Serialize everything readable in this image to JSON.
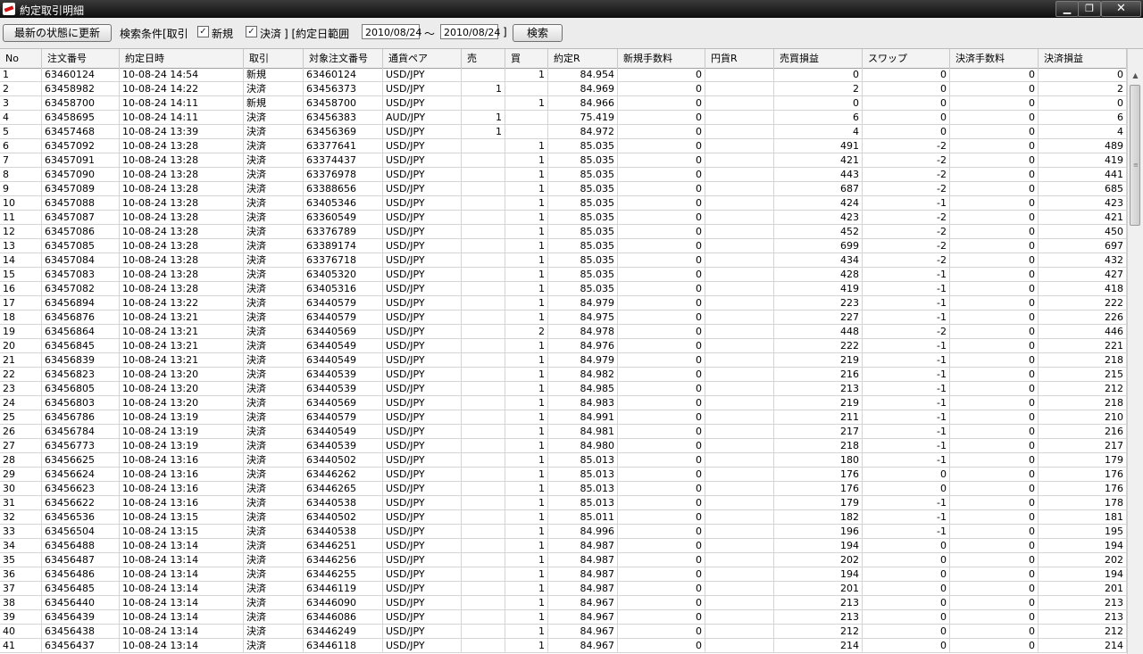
{
  "window": {
    "title": "約定取引明細",
    "min": "▁",
    "max": "❐",
    "close": "✕"
  },
  "toolbar": {
    "refresh_label": "最新の状態に更新",
    "criteria_label": "検索条件[取引",
    "new_checked": true,
    "new_label": "新規",
    "settle_checked": true,
    "settle_label": "決済",
    "range_label": "]  [約定日範囲",
    "date_from": "2010/08/24",
    "tilde": "～",
    "date_to": "2010/08/24",
    "close_bracket": "]",
    "search_label": "検索"
  },
  "grid": {
    "columns": [
      "No",
      "注文番号",
      "約定日時",
      "取引",
      "対象注文番号",
      "通貨ペア",
      "売",
      "買",
      "約定R",
      "新規手数料",
      "円貨R",
      "売買損益",
      "スワップ",
      "決済手数料",
      "決済損益"
    ],
    "rows": [
      [
        "1",
        "63460124",
        "10-08-24 14:54",
        "新規",
        "63460124",
        "USD/JPY",
        "",
        "1",
        "84.954",
        "0",
        "",
        "0",
        "0",
        "0",
        "0"
      ],
      [
        "2",
        "63458982",
        "10-08-24 14:22",
        "決済",
        "63456373",
        "USD/JPY",
        "1",
        "",
        "84.969",
        "0",
        "",
        "2",
        "0",
        "0",
        "2"
      ],
      [
        "3",
        "63458700",
        "10-08-24 14:11",
        "新規",
        "63458700",
        "USD/JPY",
        "",
        "1",
        "84.966",
        "0",
        "",
        "0",
        "0",
        "0",
        "0"
      ],
      [
        "4",
        "63458695",
        "10-08-24 14:11",
        "決済",
        "63456383",
        "AUD/JPY",
        "1",
        "",
        "75.419",
        "0",
        "",
        "6",
        "0",
        "0",
        "6"
      ],
      [
        "5",
        "63457468",
        "10-08-24 13:39",
        "決済",
        "63456369",
        "USD/JPY",
        "1",
        "",
        "84.972",
        "0",
        "",
        "4",
        "0",
        "0",
        "4"
      ],
      [
        "6",
        "63457092",
        "10-08-24 13:28",
        "決済",
        "63377641",
        "USD/JPY",
        "",
        "1",
        "85.035",
        "0",
        "",
        "491",
        "-2",
        "0",
        "489"
      ],
      [
        "7",
        "63457091",
        "10-08-24 13:28",
        "決済",
        "63374437",
        "USD/JPY",
        "",
        "1",
        "85.035",
        "0",
        "",
        "421",
        "-2",
        "0",
        "419"
      ],
      [
        "8",
        "63457090",
        "10-08-24 13:28",
        "決済",
        "63376978",
        "USD/JPY",
        "",
        "1",
        "85.035",
        "0",
        "",
        "443",
        "-2",
        "0",
        "441"
      ],
      [
        "9",
        "63457089",
        "10-08-24 13:28",
        "決済",
        "63388656",
        "USD/JPY",
        "",
        "1",
        "85.035",
        "0",
        "",
        "687",
        "-2",
        "0",
        "685"
      ],
      [
        "10",
        "63457088",
        "10-08-24 13:28",
        "決済",
        "63405346",
        "USD/JPY",
        "",
        "1",
        "85.035",
        "0",
        "",
        "424",
        "-1",
        "0",
        "423"
      ],
      [
        "11",
        "63457087",
        "10-08-24 13:28",
        "決済",
        "63360549",
        "USD/JPY",
        "",
        "1",
        "85.035",
        "0",
        "",
        "423",
        "-2",
        "0",
        "421"
      ],
      [
        "12",
        "63457086",
        "10-08-24 13:28",
        "決済",
        "63376789",
        "USD/JPY",
        "",
        "1",
        "85.035",
        "0",
        "",
        "452",
        "-2",
        "0",
        "450"
      ],
      [
        "13",
        "63457085",
        "10-08-24 13:28",
        "決済",
        "63389174",
        "USD/JPY",
        "",
        "1",
        "85.035",
        "0",
        "",
        "699",
        "-2",
        "0",
        "697"
      ],
      [
        "14",
        "63457084",
        "10-08-24 13:28",
        "決済",
        "63376718",
        "USD/JPY",
        "",
        "1",
        "85.035",
        "0",
        "",
        "434",
        "-2",
        "0",
        "432"
      ],
      [
        "15",
        "63457083",
        "10-08-24 13:28",
        "決済",
        "63405320",
        "USD/JPY",
        "",
        "1",
        "85.035",
        "0",
        "",
        "428",
        "-1",
        "0",
        "427"
      ],
      [
        "16",
        "63457082",
        "10-08-24 13:28",
        "決済",
        "63405316",
        "USD/JPY",
        "",
        "1",
        "85.035",
        "0",
        "",
        "419",
        "-1",
        "0",
        "418"
      ],
      [
        "17",
        "63456894",
        "10-08-24 13:22",
        "決済",
        "63440579",
        "USD/JPY",
        "",
        "1",
        "84.979",
        "0",
        "",
        "223",
        "-1",
        "0",
        "222"
      ],
      [
        "18",
        "63456876",
        "10-08-24 13:21",
        "決済",
        "63440579",
        "USD/JPY",
        "",
        "1",
        "84.975",
        "0",
        "",
        "227",
        "-1",
        "0",
        "226"
      ],
      [
        "19",
        "63456864",
        "10-08-24 13:21",
        "決済",
        "63440569",
        "USD/JPY",
        "",
        "2",
        "84.978",
        "0",
        "",
        "448",
        "-2",
        "0",
        "446"
      ],
      [
        "20",
        "63456845",
        "10-08-24 13:21",
        "決済",
        "63440549",
        "USD/JPY",
        "",
        "1",
        "84.976",
        "0",
        "",
        "222",
        "-1",
        "0",
        "221"
      ],
      [
        "21",
        "63456839",
        "10-08-24 13:21",
        "決済",
        "63440549",
        "USD/JPY",
        "",
        "1",
        "84.979",
        "0",
        "",
        "219",
        "-1",
        "0",
        "218"
      ],
      [
        "22",
        "63456823",
        "10-08-24 13:20",
        "決済",
        "63440539",
        "USD/JPY",
        "",
        "1",
        "84.982",
        "0",
        "",
        "216",
        "-1",
        "0",
        "215"
      ],
      [
        "23",
        "63456805",
        "10-08-24 13:20",
        "決済",
        "63440539",
        "USD/JPY",
        "",
        "1",
        "84.985",
        "0",
        "",
        "213",
        "-1",
        "0",
        "212"
      ],
      [
        "24",
        "63456803",
        "10-08-24 13:20",
        "決済",
        "63440569",
        "USD/JPY",
        "",
        "1",
        "84.983",
        "0",
        "",
        "219",
        "-1",
        "0",
        "218"
      ],
      [
        "25",
        "63456786",
        "10-08-24 13:19",
        "決済",
        "63440579",
        "USD/JPY",
        "",
        "1",
        "84.991",
        "0",
        "",
        "211",
        "-1",
        "0",
        "210"
      ],
      [
        "26",
        "63456784",
        "10-08-24 13:19",
        "決済",
        "63440549",
        "USD/JPY",
        "",
        "1",
        "84.981",
        "0",
        "",
        "217",
        "-1",
        "0",
        "216"
      ],
      [
        "27",
        "63456773",
        "10-08-24 13:19",
        "決済",
        "63440539",
        "USD/JPY",
        "",
        "1",
        "84.980",
        "0",
        "",
        "218",
        "-1",
        "0",
        "217"
      ],
      [
        "28",
        "63456625",
        "10-08-24 13:16",
        "決済",
        "63440502",
        "USD/JPY",
        "",
        "1",
        "85.013",
        "0",
        "",
        "180",
        "-1",
        "0",
        "179"
      ],
      [
        "29",
        "63456624",
        "10-08-24 13:16",
        "決済",
        "63446262",
        "USD/JPY",
        "",
        "1",
        "85.013",
        "0",
        "",
        "176",
        "0",
        "0",
        "176"
      ],
      [
        "30",
        "63456623",
        "10-08-24 13:16",
        "決済",
        "63446265",
        "USD/JPY",
        "",
        "1",
        "85.013",
        "0",
        "",
        "176",
        "0",
        "0",
        "176"
      ],
      [
        "31",
        "63456622",
        "10-08-24 13:16",
        "決済",
        "63440538",
        "USD/JPY",
        "",
        "1",
        "85.013",
        "0",
        "",
        "179",
        "-1",
        "0",
        "178"
      ],
      [
        "32",
        "63456536",
        "10-08-24 13:15",
        "決済",
        "63440502",
        "USD/JPY",
        "",
        "1",
        "85.011",
        "0",
        "",
        "182",
        "-1",
        "0",
        "181"
      ],
      [
        "33",
        "63456504",
        "10-08-24 13:15",
        "決済",
        "63440538",
        "USD/JPY",
        "",
        "1",
        "84.996",
        "0",
        "",
        "196",
        "-1",
        "0",
        "195"
      ],
      [
        "34",
        "63456488",
        "10-08-24 13:14",
        "決済",
        "63446251",
        "USD/JPY",
        "",
        "1",
        "84.987",
        "0",
        "",
        "194",
        "0",
        "0",
        "194"
      ],
      [
        "35",
        "63456487",
        "10-08-24 13:14",
        "決済",
        "63446256",
        "USD/JPY",
        "",
        "1",
        "84.987",
        "0",
        "",
        "202",
        "0",
        "0",
        "202"
      ],
      [
        "36",
        "63456486",
        "10-08-24 13:14",
        "決済",
        "63446255",
        "USD/JPY",
        "",
        "1",
        "84.987",
        "0",
        "",
        "194",
        "0",
        "0",
        "194"
      ],
      [
        "37",
        "63456485",
        "10-08-24 13:14",
        "決済",
        "63446119",
        "USD/JPY",
        "",
        "1",
        "84.987",
        "0",
        "",
        "201",
        "0",
        "0",
        "201"
      ],
      [
        "38",
        "63456440",
        "10-08-24 13:14",
        "決済",
        "63446090",
        "USD/JPY",
        "",
        "1",
        "84.967",
        "0",
        "",
        "213",
        "0",
        "0",
        "213"
      ],
      [
        "39",
        "63456439",
        "10-08-24 13:14",
        "決済",
        "63446086",
        "USD/JPY",
        "",
        "1",
        "84.967",
        "0",
        "",
        "213",
        "0",
        "0",
        "213"
      ],
      [
        "40",
        "63456438",
        "10-08-24 13:14",
        "決済",
        "63446249",
        "USD/JPY",
        "",
        "1",
        "84.967",
        "0",
        "",
        "212",
        "0",
        "0",
        "212"
      ],
      [
        "41",
        "63456437",
        "10-08-24 13:14",
        "決済",
        "63446118",
        "USD/JPY",
        "",
        "1",
        "84.967",
        "0",
        "",
        "214",
        "0",
        "0",
        "214"
      ]
    ]
  }
}
